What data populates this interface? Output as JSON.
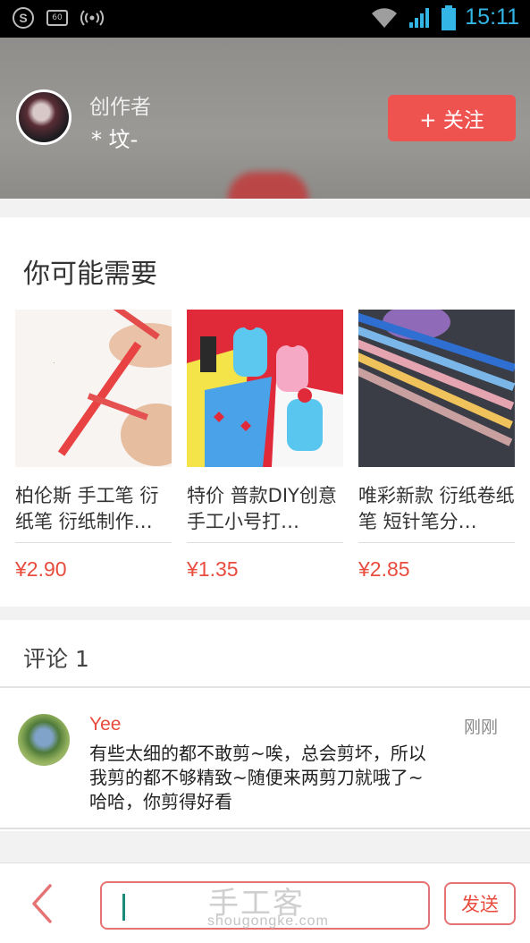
{
  "status_bar": {
    "time": "15:11",
    "icons": [
      "sogou-input-icon",
      "sim-60-icon",
      "hotspot-icon",
      "wifi-icon",
      "signal-icon",
      "battery-icon"
    ],
    "sim_label": "60",
    "sogou_label": "S"
  },
  "creator": {
    "label": "创作者",
    "name": "* 坟-",
    "follow_label": "+ 关注"
  },
  "recommend": {
    "title": "你可能需要",
    "products": [
      {
        "name": "柏伦斯 手工笔 衍纸笔 衍纸制作…",
        "price": "¥2.90"
      },
      {
        "name": "特价 普款DIY创意手工小号打…",
        "price": "¥1.35"
      },
      {
        "name": "唯彩新款  衍纸卷纸笔 短针笔分…",
        "price": "¥2.85"
      }
    ]
  },
  "comments": {
    "title": "评论 1",
    "items": [
      {
        "user": "Yee",
        "time": "刚刚",
        "text": "有些太细的都不敢剪~唉，总会剪坏，所以我剪的都不够精致~随便来两剪刀就哦了~哈哈，你剪得好看"
      }
    ]
  },
  "bottom_bar": {
    "send_label": "发送",
    "input_value": "",
    "watermark": "手工客",
    "watermark_sub": "shougongke.com"
  },
  "colors": {
    "accent": "#ef5350",
    "price": "#e84c3d",
    "status_time": "#33b5e5"
  }
}
